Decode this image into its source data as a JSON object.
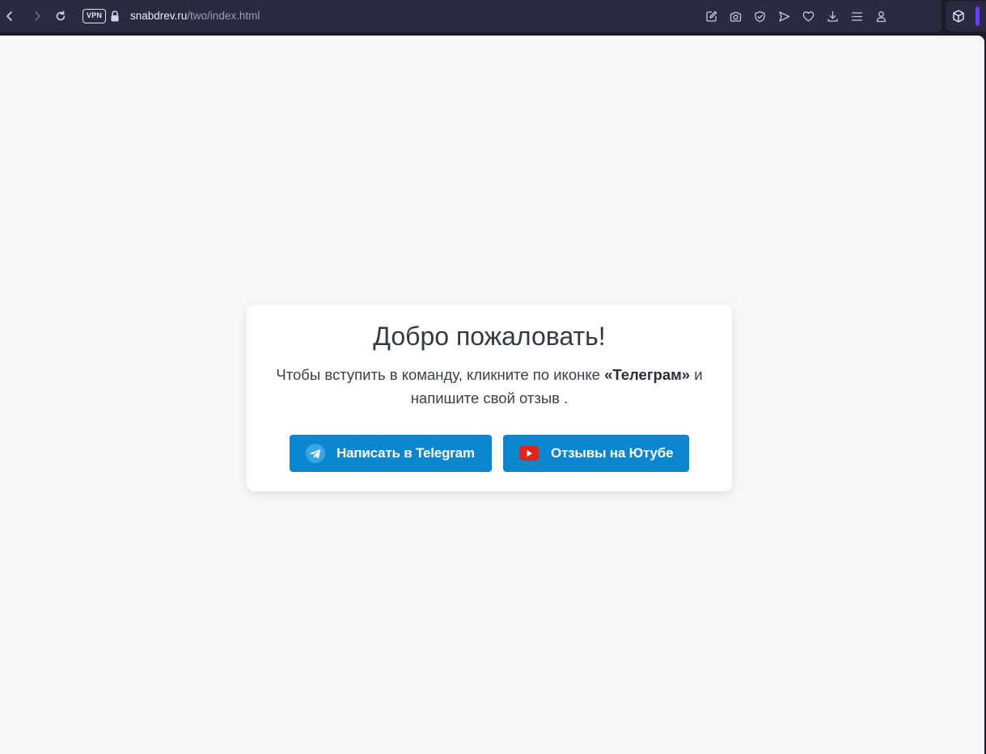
{
  "browser": {
    "vpn_label": "VPN",
    "url_host": "snabdrev.ru",
    "url_path": "/two/index.html",
    "toolbar_icons": [
      "edit-icon",
      "camera-icon",
      "shield-icon",
      "send-icon",
      "heart-icon",
      "download-icon",
      "menu-lines-icon",
      "profile-icon"
    ],
    "extension_icon": "cube-icon",
    "accent_color": "#6c3cff"
  },
  "card": {
    "title": "Добро пожаловать!",
    "text_before": "Чтобы вступить в команду, кликните по иконке ",
    "text_bold": "«Телеграм»",
    "text_after": " и напишите свой отзыв ."
  },
  "buttons": {
    "telegram_label": "Написать в Telegram",
    "youtube_label": "Отзывы на Ютубе",
    "button_color": "#0b87d1"
  }
}
